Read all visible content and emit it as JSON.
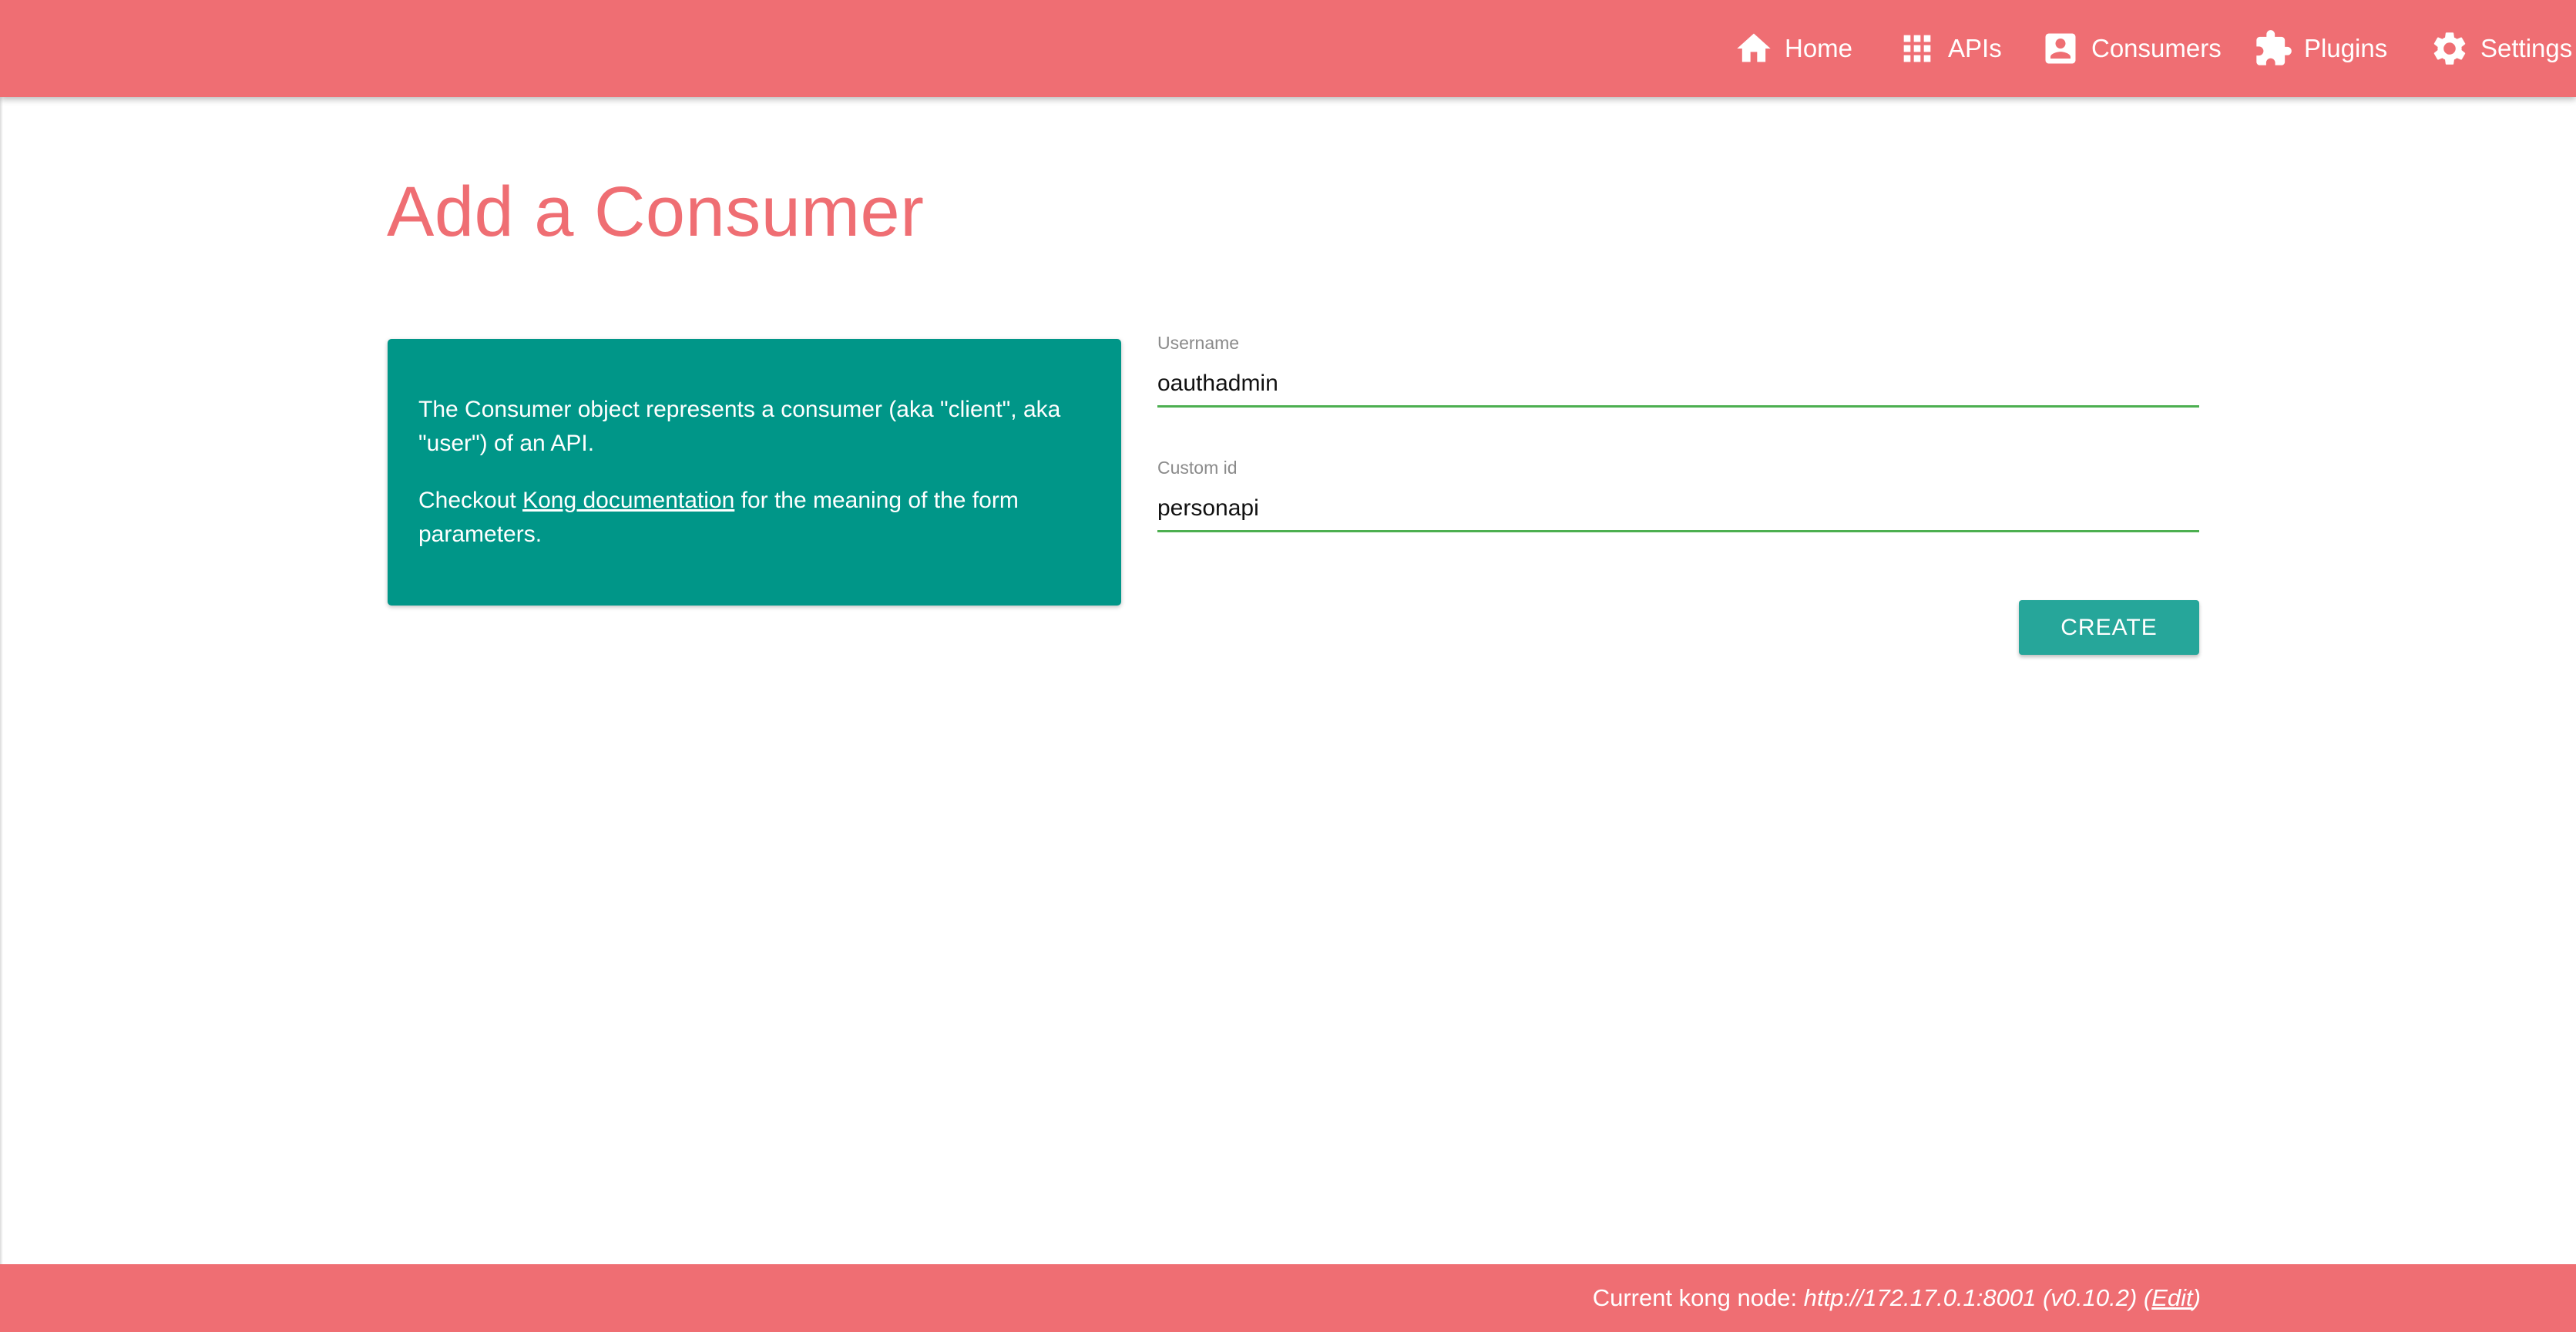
{
  "nav": {
    "items": [
      {
        "label": "Home",
        "icon": "home-icon"
      },
      {
        "label": "APIs",
        "icon": "grid-icon"
      },
      {
        "label": "Consumers",
        "icon": "account-box-icon"
      },
      {
        "label": "Plugins",
        "icon": "puzzle-icon"
      },
      {
        "label": "Settings",
        "icon": "gear-icon"
      }
    ]
  },
  "page": {
    "title": "Add a Consumer"
  },
  "info": {
    "description": "The Consumer object represents a consumer (aka \"client\", aka \"user\") of an API.",
    "checkout_prefix": "Checkout ",
    "doc_link": "Kong documentation",
    "checkout_suffix": " for the meaning of the form parameters."
  },
  "form": {
    "username": {
      "label": "Username",
      "value": "oauthadmin"
    },
    "custom_id": {
      "label": "Custom id",
      "value": "personapi"
    },
    "submit_label": "CREATE"
  },
  "footer": {
    "prefix": "Current kong node: ",
    "node_url": "http://172.17.0.1:8001 (v0.10.2)",
    "edit_open": " (",
    "edit_label": "Edit",
    "edit_close": ")"
  },
  "colors": {
    "brand": "#ef6e73",
    "info_card": "#009688",
    "button": "#26a69a",
    "input_underline": "#4caf50"
  }
}
